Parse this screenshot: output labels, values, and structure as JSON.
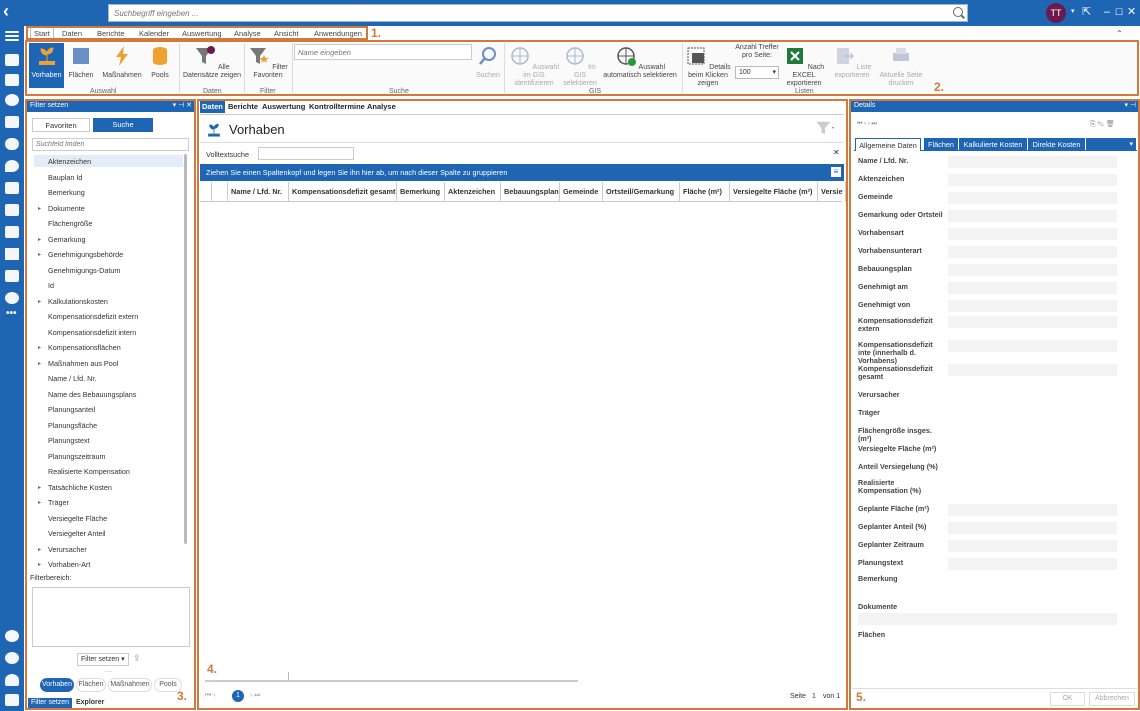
{
  "search": {
    "placeholder": "Suchbegriff eingeben ..."
  },
  "user": {
    "initials": "TT"
  },
  "menu": [
    "Start",
    "Daten",
    "Berichte",
    "Kalender",
    "Auswertung",
    "Analyse",
    "Ansicht",
    "Anwendungen"
  ],
  "labels": {
    "n1": "1.",
    "n2": "2.",
    "n3": "3.",
    "n4": "4.",
    "n5": "5."
  },
  "ribbon": {
    "vorhaben": "Vorhaben",
    "flaechen": "Flächen",
    "massnahmen": "Maßnahmen",
    "pools": "Pools",
    "auswahl": "Auswahl",
    "alle": "Alle Datensätze zeigen",
    "daten": "Daten",
    "filter_fav": "Filter Favoriten",
    "filter": "Filter",
    "name_placeholder": "Name eingeben",
    "suchen": "Suchen",
    "suche": "Suche",
    "gis1": "Auswahl im GIS identifizieren",
    "gis2": "Im GIS selektieren",
    "gis3": "Auswahl automatisch selektieren",
    "gis": "GIS",
    "details_click": "Details beim Klicken zeigen",
    "anzahl": "Anzahl Treffer pro Seite:",
    "anzahl_val": "100",
    "excel": "Nach EXCEL exportieren",
    "liste_export": "Liste exportieren",
    "druck": "Aktuelle Seite drucken",
    "listen": "Listen"
  },
  "filterpanel": {
    "title": "Filter setzen",
    "fav": "Favoriten",
    "suche": "Suche",
    "find_placeholder": "Suchfeld finden",
    "items": [
      "Aktenzeichen",
      "Bauplan Id",
      "Bemerkung",
      "Dokumente",
      "Flächengröße",
      "Gemarkung",
      "Genehmigungsbehörde",
      "Genehmigungs-Datum",
      "Id",
      "Kalkulationskosten",
      "Kompensationsdefizit extern",
      "Kompensationsdefizit intern",
      "Kompensationsflächen",
      "Maßnahmen aus Pool",
      "Name / Lfd. Nr.",
      "Name des Bebauungsplans",
      "Planungsanteil",
      "Planungsfläche",
      "Planungstext",
      "Planungszeitraum",
      "Realisierte Kompensation",
      "Tatsächliche Kosten",
      "Träger",
      "Versiegelte Fläche",
      "Versiegelter Anteil",
      "Verursacher",
      "Vorhaben-Art"
    ],
    "bereich": "Filterbereich:",
    "setzen": "Filter setzen",
    "chips": [
      "Vorhaben",
      "Flächen",
      "Maßnahmen",
      "Pools"
    ],
    "bottom": [
      "Filter setzen",
      "Explorer"
    ]
  },
  "main": {
    "tabs": [
      "Daten",
      "Berichte",
      "Auswertung",
      "Kontrolltermine",
      "Analyse"
    ],
    "title": "Vorhaben",
    "volltext": "Volltextsuche",
    "groupbar": "Ziehen Sie einen Spaltenkopf und legen Sie ihn hier ab, um nach dieser Spalte zu gruppieren",
    "cols": [
      "Name / Lfd. Nr.",
      "Kompensationsdefizit gesamt",
      "Bemerkung",
      "Aktenzeichen",
      "Bebauungsplan",
      "Gemeinde",
      "Ortsteil/Gemarkung",
      "Fläche (m²)",
      "Versiegelte Fläche (m²)",
      "Versie"
    ],
    "page": "1",
    "seite": "Seite",
    "seite_val": "1",
    "von": "von 1"
  },
  "details": {
    "title": "Details",
    "tabs": [
      "Allgemeine Daten",
      "Flächen",
      "Kalkulierte Kosten",
      "Direkte Kosten"
    ],
    "fields": [
      "Name / Lfd. Nr.",
      "Aktenzeichen",
      "Gemeinde",
      "Gemarkung oder Ortsteil",
      "Vorhabensart",
      "Vorhabensunterart",
      "Bebauungsplan",
      "Genehmigt am",
      "Genehmigt von",
      "Kompensationsdefizit extern",
      "Kompensationsdefizit inte (innerhalb d. Vorhabens)",
      "Kompensationsdefizit gesamt",
      "Verursacher",
      "Träger",
      "Flächengröße insges. (m²)",
      "Versiegelte Fläche (m²)",
      "Anteil Versiegelung (%)",
      "Realisierte Kompensation (%)",
      "Geplante Fläche (m²)",
      "Geplanter Anteil (%)",
      "Geplanter Zeitraum",
      "Planungstext",
      "Bemerkung",
      "Dokumente",
      "Flächen"
    ],
    "ok": "OK",
    "abbrechen": "Abbrechen"
  }
}
